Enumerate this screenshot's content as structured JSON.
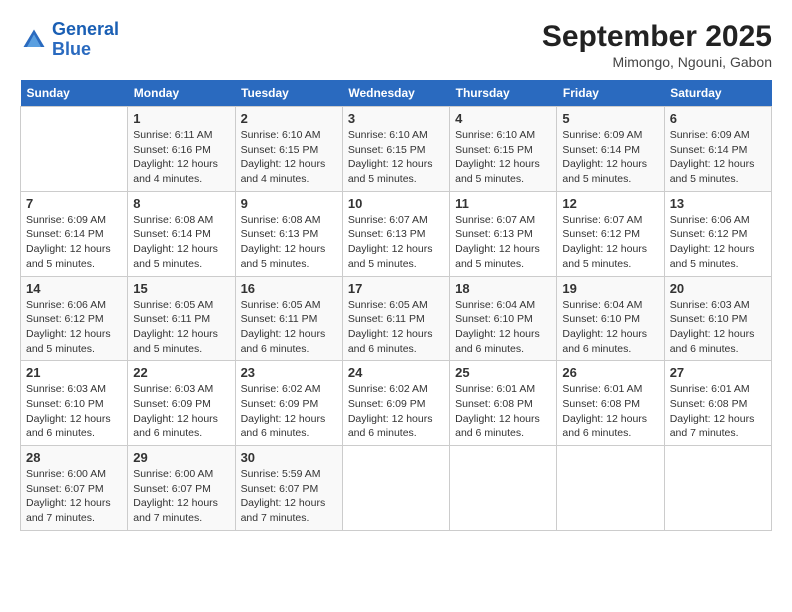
{
  "logo": {
    "line1": "General",
    "line2": "Blue"
  },
  "title": "September 2025",
  "subtitle": "Mimongo, Ngouni, Gabon",
  "days_of_week": [
    "Sunday",
    "Monday",
    "Tuesday",
    "Wednesday",
    "Thursday",
    "Friday",
    "Saturday"
  ],
  "weeks": [
    [
      {
        "day": "",
        "info": ""
      },
      {
        "day": "1",
        "info": "Sunrise: 6:11 AM\nSunset: 6:16 PM\nDaylight: 12 hours\nand 4 minutes."
      },
      {
        "day": "2",
        "info": "Sunrise: 6:10 AM\nSunset: 6:15 PM\nDaylight: 12 hours\nand 4 minutes."
      },
      {
        "day": "3",
        "info": "Sunrise: 6:10 AM\nSunset: 6:15 PM\nDaylight: 12 hours\nand 5 minutes."
      },
      {
        "day": "4",
        "info": "Sunrise: 6:10 AM\nSunset: 6:15 PM\nDaylight: 12 hours\nand 5 minutes."
      },
      {
        "day": "5",
        "info": "Sunrise: 6:09 AM\nSunset: 6:14 PM\nDaylight: 12 hours\nand 5 minutes."
      },
      {
        "day": "6",
        "info": "Sunrise: 6:09 AM\nSunset: 6:14 PM\nDaylight: 12 hours\nand 5 minutes."
      }
    ],
    [
      {
        "day": "7",
        "info": "Sunrise: 6:09 AM\nSunset: 6:14 PM\nDaylight: 12 hours\nand 5 minutes."
      },
      {
        "day": "8",
        "info": "Sunrise: 6:08 AM\nSunset: 6:14 PM\nDaylight: 12 hours\nand 5 minutes."
      },
      {
        "day": "9",
        "info": "Sunrise: 6:08 AM\nSunset: 6:13 PM\nDaylight: 12 hours\nand 5 minutes."
      },
      {
        "day": "10",
        "info": "Sunrise: 6:07 AM\nSunset: 6:13 PM\nDaylight: 12 hours\nand 5 minutes."
      },
      {
        "day": "11",
        "info": "Sunrise: 6:07 AM\nSunset: 6:13 PM\nDaylight: 12 hours\nand 5 minutes."
      },
      {
        "day": "12",
        "info": "Sunrise: 6:07 AM\nSunset: 6:12 PM\nDaylight: 12 hours\nand 5 minutes."
      },
      {
        "day": "13",
        "info": "Sunrise: 6:06 AM\nSunset: 6:12 PM\nDaylight: 12 hours\nand 5 minutes."
      }
    ],
    [
      {
        "day": "14",
        "info": "Sunrise: 6:06 AM\nSunset: 6:12 PM\nDaylight: 12 hours\nand 5 minutes."
      },
      {
        "day": "15",
        "info": "Sunrise: 6:05 AM\nSunset: 6:11 PM\nDaylight: 12 hours\nand 5 minutes."
      },
      {
        "day": "16",
        "info": "Sunrise: 6:05 AM\nSunset: 6:11 PM\nDaylight: 12 hours\nand 6 minutes."
      },
      {
        "day": "17",
        "info": "Sunrise: 6:05 AM\nSunset: 6:11 PM\nDaylight: 12 hours\nand 6 minutes."
      },
      {
        "day": "18",
        "info": "Sunrise: 6:04 AM\nSunset: 6:10 PM\nDaylight: 12 hours\nand 6 minutes."
      },
      {
        "day": "19",
        "info": "Sunrise: 6:04 AM\nSunset: 6:10 PM\nDaylight: 12 hours\nand 6 minutes."
      },
      {
        "day": "20",
        "info": "Sunrise: 6:03 AM\nSunset: 6:10 PM\nDaylight: 12 hours\nand 6 minutes."
      }
    ],
    [
      {
        "day": "21",
        "info": "Sunrise: 6:03 AM\nSunset: 6:10 PM\nDaylight: 12 hours\nand 6 minutes."
      },
      {
        "day": "22",
        "info": "Sunrise: 6:03 AM\nSunset: 6:09 PM\nDaylight: 12 hours\nand 6 minutes."
      },
      {
        "day": "23",
        "info": "Sunrise: 6:02 AM\nSunset: 6:09 PM\nDaylight: 12 hours\nand 6 minutes."
      },
      {
        "day": "24",
        "info": "Sunrise: 6:02 AM\nSunset: 6:09 PM\nDaylight: 12 hours\nand 6 minutes."
      },
      {
        "day": "25",
        "info": "Sunrise: 6:01 AM\nSunset: 6:08 PM\nDaylight: 12 hours\nand 6 minutes."
      },
      {
        "day": "26",
        "info": "Sunrise: 6:01 AM\nSunset: 6:08 PM\nDaylight: 12 hours\nand 6 minutes."
      },
      {
        "day": "27",
        "info": "Sunrise: 6:01 AM\nSunset: 6:08 PM\nDaylight: 12 hours\nand 7 minutes."
      }
    ],
    [
      {
        "day": "28",
        "info": "Sunrise: 6:00 AM\nSunset: 6:07 PM\nDaylight: 12 hours\nand 7 minutes."
      },
      {
        "day": "29",
        "info": "Sunrise: 6:00 AM\nSunset: 6:07 PM\nDaylight: 12 hours\nand 7 minutes."
      },
      {
        "day": "30",
        "info": "Sunrise: 5:59 AM\nSunset: 6:07 PM\nDaylight: 12 hours\nand 7 minutes."
      },
      {
        "day": "",
        "info": ""
      },
      {
        "day": "",
        "info": ""
      },
      {
        "day": "",
        "info": ""
      },
      {
        "day": "",
        "info": ""
      }
    ]
  ]
}
